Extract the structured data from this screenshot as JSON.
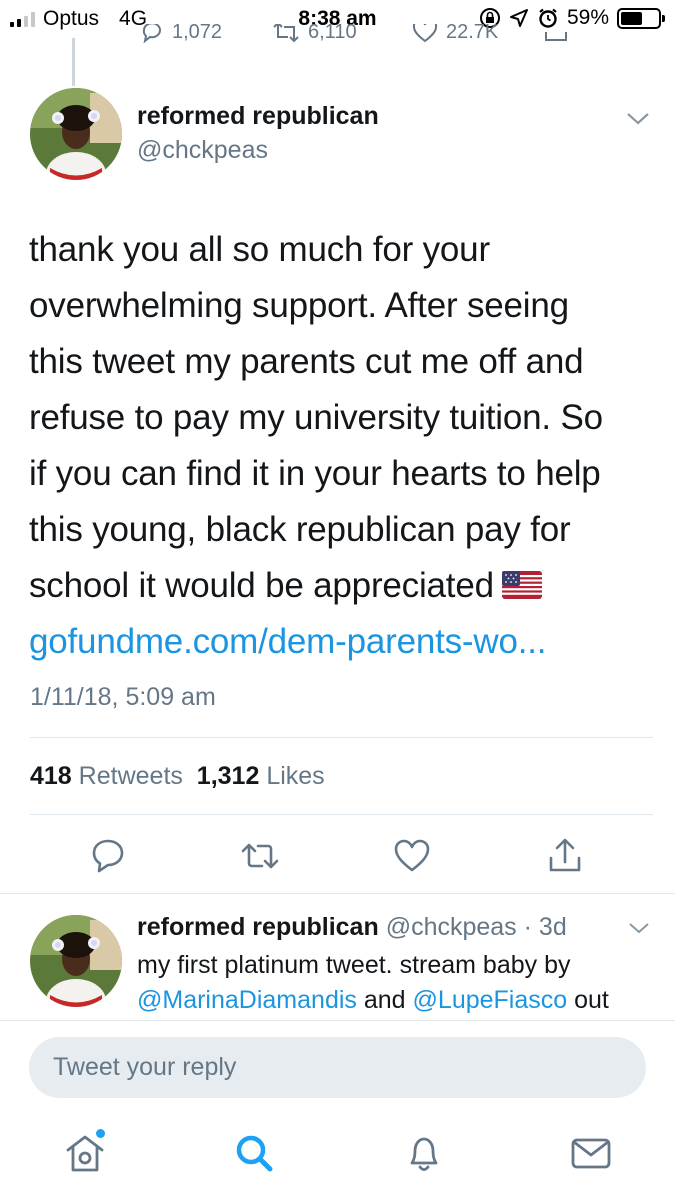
{
  "status_bar": {
    "carrier": "Optus",
    "network": "4G",
    "time": "8:38 am",
    "battery_percent": "59%",
    "battery_level": 0.59,
    "signal_bars_on": 2,
    "signal_bars_total": 4
  },
  "previous_tweet_actions": {
    "replies": "1,072",
    "retweets": "6,110",
    "likes": "22.7K"
  },
  "main_tweet": {
    "author_name": "reformed republican",
    "author_handle": "@chckpeas",
    "text_lines": [
      "thank you all so much for your",
      "overwhelming support. After seeing",
      "this tweet my parents cut me off and",
      "refuse to pay my university tuition. So",
      "if you can find it in your hearts to help",
      "this young, black republican pay for",
      "school it would be appreciated"
    ],
    "link": "gofundme.com/dem-parents-wo...",
    "timestamp": "1/11/18, 5:09 am",
    "retweet_count": "418",
    "retweets_label": "Retweets",
    "like_count": "1,312",
    "likes_label": "Likes"
  },
  "second_tweet": {
    "author_name": "reformed republican",
    "author_handle": "@chckpeas",
    "separator": "·",
    "age": "3d",
    "line1": "my first platinum tweet. stream baby by",
    "mention1": "@MarinaDiamandis",
    "conjunction": "and",
    "mention2": "@LupeFiasco",
    "tail": "out"
  },
  "reply_bar": {
    "placeholder": "Tweet your reply"
  },
  "icons": {
    "reply": "reply-icon",
    "retweet": "retweet-icon",
    "like": "heart-icon",
    "share": "share-icon",
    "home": "home-icon",
    "search": "search-icon",
    "notifications": "bell-icon",
    "messages": "mail-icon"
  },
  "colors": {
    "accent": "#1da1f2",
    "link": "#1b95e0",
    "text": "#14171a",
    "secondary": "#657786",
    "divider": "#e1e8ed",
    "input_bg": "#e6ecf0"
  }
}
